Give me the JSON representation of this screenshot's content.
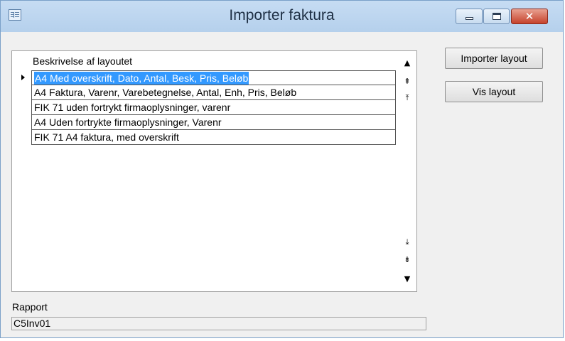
{
  "window": {
    "title": "Importer faktura",
    "close_glyph": "✕"
  },
  "grid": {
    "header": "Beskrivelse af layoutet",
    "rows": [
      "A4 Med overskrift, Dato, Antal, Besk, Pris, Beløb",
      "A4 Faktura, Varenr, Varebetegnelse, Antal, Enh, Pris, Beløb",
      "FIK 71 uden fortrykt firmaoplysninger, varenr",
      "A4 Uden fortrykte firmaoplysninger, Varenr",
      "FIK 71 A4 faktura, med overskrift"
    ],
    "selected_row_index": 0,
    "scroll_glyphs": {
      "up": "▲",
      "page_up": "⇞",
      "top": "⤒",
      "bottom": "⤓",
      "page_down": "⇟",
      "down": "▼"
    }
  },
  "buttons": {
    "import_layout": "Importer layout",
    "show_layout": "Vis layout"
  },
  "rapport": {
    "label": "Rapport",
    "value": "C5Inv01"
  }
}
